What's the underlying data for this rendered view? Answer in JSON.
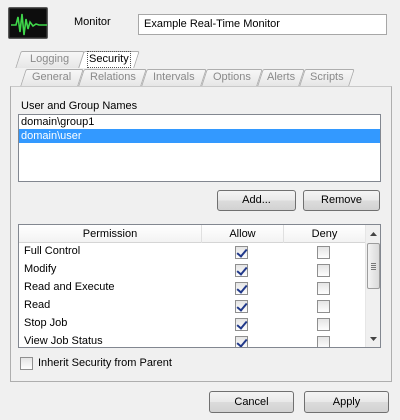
{
  "header": {
    "monitor_label": "Monitor",
    "monitor_name": "Example Real-Time Monitor",
    "icon": "waveform-monitor-icon"
  },
  "tabs": {
    "row_back": [
      {
        "label": "Logging",
        "active": false
      },
      {
        "label": "Security",
        "active": true
      }
    ],
    "row_front": [
      {
        "label": "General"
      },
      {
        "label": "Relations"
      },
      {
        "label": "Intervals"
      },
      {
        "label": "Options"
      },
      {
        "label": "Alerts"
      },
      {
        "label": "Scripts"
      }
    ]
  },
  "security": {
    "names_caption": "User and Group Names",
    "names": [
      {
        "label": "domain\\group1",
        "selected": false
      },
      {
        "label": "domain\\user",
        "selected": true
      }
    ],
    "add_label": "Add...",
    "remove_label": "Remove",
    "columns": [
      "Permission",
      "Allow",
      "Deny"
    ],
    "permissions": [
      {
        "name": "Full Control",
        "allow": true,
        "deny": false
      },
      {
        "name": "Modify",
        "allow": true,
        "deny": false
      },
      {
        "name": "Read and Execute",
        "allow": true,
        "deny": false
      },
      {
        "name": "Read",
        "allow": true,
        "deny": false
      },
      {
        "name": "Stop Job",
        "allow": true,
        "deny": false
      },
      {
        "name": "View Job Status",
        "allow": true,
        "deny": false
      }
    ],
    "inherit_label": "Inherit Security from Parent",
    "inherit_checked": false
  },
  "footer": {
    "cancel_label": "Cancel",
    "apply_label": "Apply"
  },
  "colors": {
    "selection": "#3399ff",
    "check": "#21398a",
    "icon_wave": "#3fd64a"
  }
}
